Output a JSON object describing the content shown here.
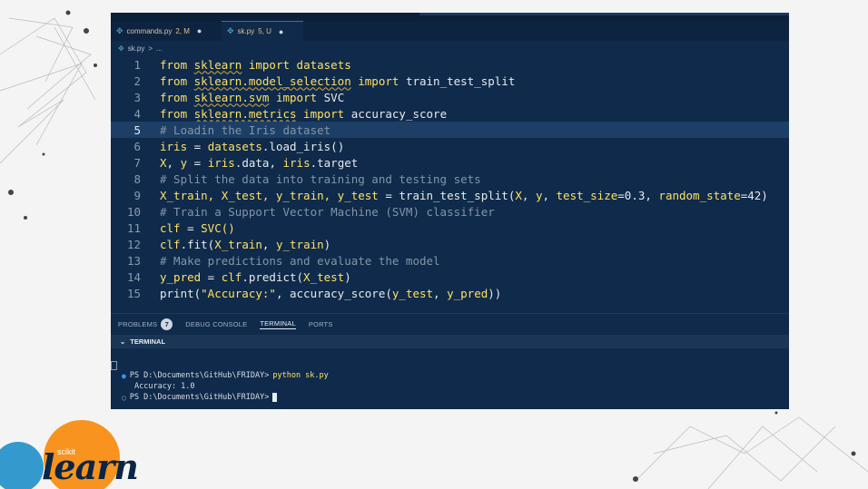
{
  "tabs": [
    {
      "file": "commands.py",
      "status": "2, M",
      "mod": "●"
    },
    {
      "file": "sk.py",
      "status": "5, U",
      "mod": "●"
    }
  ],
  "breadcrumb": {
    "file": "sk.py",
    "sep": ">",
    "rest": "..."
  },
  "code": [
    {
      "n": "1",
      "parts": [
        {
          "t": "from ",
          "c": "kw"
        },
        {
          "t": "sklearn",
          "c": "kw squig"
        },
        {
          "t": " import ",
          "c": "kw"
        },
        {
          "t": "datasets",
          "c": "kw"
        }
      ]
    },
    {
      "n": "2",
      "parts": [
        {
          "t": "from ",
          "c": "kw"
        },
        {
          "t": "sklearn.model_selection",
          "c": "kw squig"
        },
        {
          "t": " import ",
          "c": "kw"
        },
        {
          "t": "train_test_split",
          "c": "txt"
        }
      ]
    },
    {
      "n": "3",
      "parts": [
        {
          "t": "from ",
          "c": "kw"
        },
        {
          "t": "sklearn.svm",
          "c": "kw squig"
        },
        {
          "t": " import ",
          "c": "kw"
        },
        {
          "t": "SVC",
          "c": "txt"
        }
      ]
    },
    {
      "n": "4",
      "parts": [
        {
          "t": "from ",
          "c": "kw"
        },
        {
          "t": "sklearn.metrics",
          "c": "kw squig"
        },
        {
          "t": " import ",
          "c": "kw"
        },
        {
          "t": "accuracy_score",
          "c": "txt"
        }
      ]
    },
    {
      "n": "5",
      "hl": true,
      "parts": [
        {
          "t": "# Loadin the Iris dataset",
          "c": "cm"
        }
      ]
    },
    {
      "n": "6",
      "parts": [
        {
          "t": "iris",
          "c": "kw"
        },
        {
          "t": " = ",
          "c": "txt"
        },
        {
          "t": "datasets",
          "c": "kw"
        },
        {
          "t": ".load_iris()",
          "c": "txt"
        }
      ]
    },
    {
      "n": "7",
      "parts": [
        {
          "t": "X",
          "c": "kw"
        },
        {
          "t": ", ",
          "c": "txt"
        },
        {
          "t": "y",
          "c": "kw"
        },
        {
          "t": " = ",
          "c": "txt"
        },
        {
          "t": "iris",
          "c": "kw"
        },
        {
          "t": ".data, ",
          "c": "txt"
        },
        {
          "t": "iris",
          "c": "kw"
        },
        {
          "t": ".target",
          "c": "txt"
        }
      ]
    },
    {
      "n": "8",
      "parts": [
        {
          "t": "# Split the data into training and testing sets",
          "c": "cm"
        }
      ]
    },
    {
      "n": "9",
      "parts": [
        {
          "t": "X_train, X_test, y_train, y_test",
          "c": "kw"
        },
        {
          "t": " = train_test_split(",
          "c": "txt"
        },
        {
          "t": "X",
          "c": "kw"
        },
        {
          "t": ", ",
          "c": "txt"
        },
        {
          "t": "y",
          "c": "kw"
        },
        {
          "t": ", ",
          "c": "txt"
        },
        {
          "t": "test_size",
          "c": "kw"
        },
        {
          "t": "=0.3, ",
          "c": "txt"
        },
        {
          "t": "random_state",
          "c": "kw"
        },
        {
          "t": "=42)",
          "c": "txt"
        }
      ]
    },
    {
      "n": "10",
      "parts": [
        {
          "t": "# Train a Support Vector Machine (SVM) classifier",
          "c": "cm"
        }
      ]
    },
    {
      "n": "11",
      "parts": [
        {
          "t": "clf",
          "c": "kw"
        },
        {
          "t": " = ",
          "c": "txt"
        },
        {
          "t": "SVC()",
          "c": "kw"
        }
      ]
    },
    {
      "n": "12",
      "parts": [
        {
          "t": "clf",
          "c": "kw"
        },
        {
          "t": ".fit(",
          "c": "txt"
        },
        {
          "t": "X_train",
          "c": "kw"
        },
        {
          "t": ", ",
          "c": "txt"
        },
        {
          "t": "y_train",
          "c": "kw"
        },
        {
          "t": ")",
          "c": "txt"
        }
      ]
    },
    {
      "n": "13",
      "parts": [
        {
          "t": "# Make predictions and evaluate the model",
          "c": "cm"
        }
      ]
    },
    {
      "n": "14",
      "parts": [
        {
          "t": "y_pred",
          "c": "kw"
        },
        {
          "t": " = ",
          "c": "txt"
        },
        {
          "t": "clf",
          "c": "kw"
        },
        {
          "t": ".predict(",
          "c": "txt"
        },
        {
          "t": "X_test",
          "c": "kw"
        },
        {
          "t": ")",
          "c": "txt"
        }
      ]
    },
    {
      "n": "15",
      "parts": [
        {
          "t": "print(",
          "c": "txt"
        },
        {
          "t": "\"Accuracy:\"",
          "c": "kw"
        },
        {
          "t": ", accuracy_score(",
          "c": "txt"
        },
        {
          "t": "y_test",
          "c": "kw"
        },
        {
          "t": ", ",
          "c": "txt"
        },
        {
          "t": "y_pred",
          "c": "kw"
        },
        {
          "t": "))",
          "c": "txt"
        }
      ]
    }
  ],
  "panel": {
    "problems": "PROBLEMS",
    "problems_count": "7",
    "debug": "DEBUG CONSOLE",
    "terminal": "TERMINAL",
    "ports": "PORTS"
  },
  "terminal": {
    "header": "TERMINAL",
    "prompt1": "PS D:\\Documents\\GitHub\\FRIDAY>",
    "cmd1": "python sk.py",
    "output": "Accuracy: 1.0",
    "prompt2": "PS D:\\Documents\\GitHub\\FRIDAY>"
  },
  "logo": {
    "small": "scikit",
    "big": "learn"
  },
  "colors": {
    "editor_bg": "#0f2a4a",
    "keyword": "#ffe066",
    "comment": "#8395a9",
    "logo_orange": "#f7931e",
    "logo_blue": "#3499cd"
  }
}
